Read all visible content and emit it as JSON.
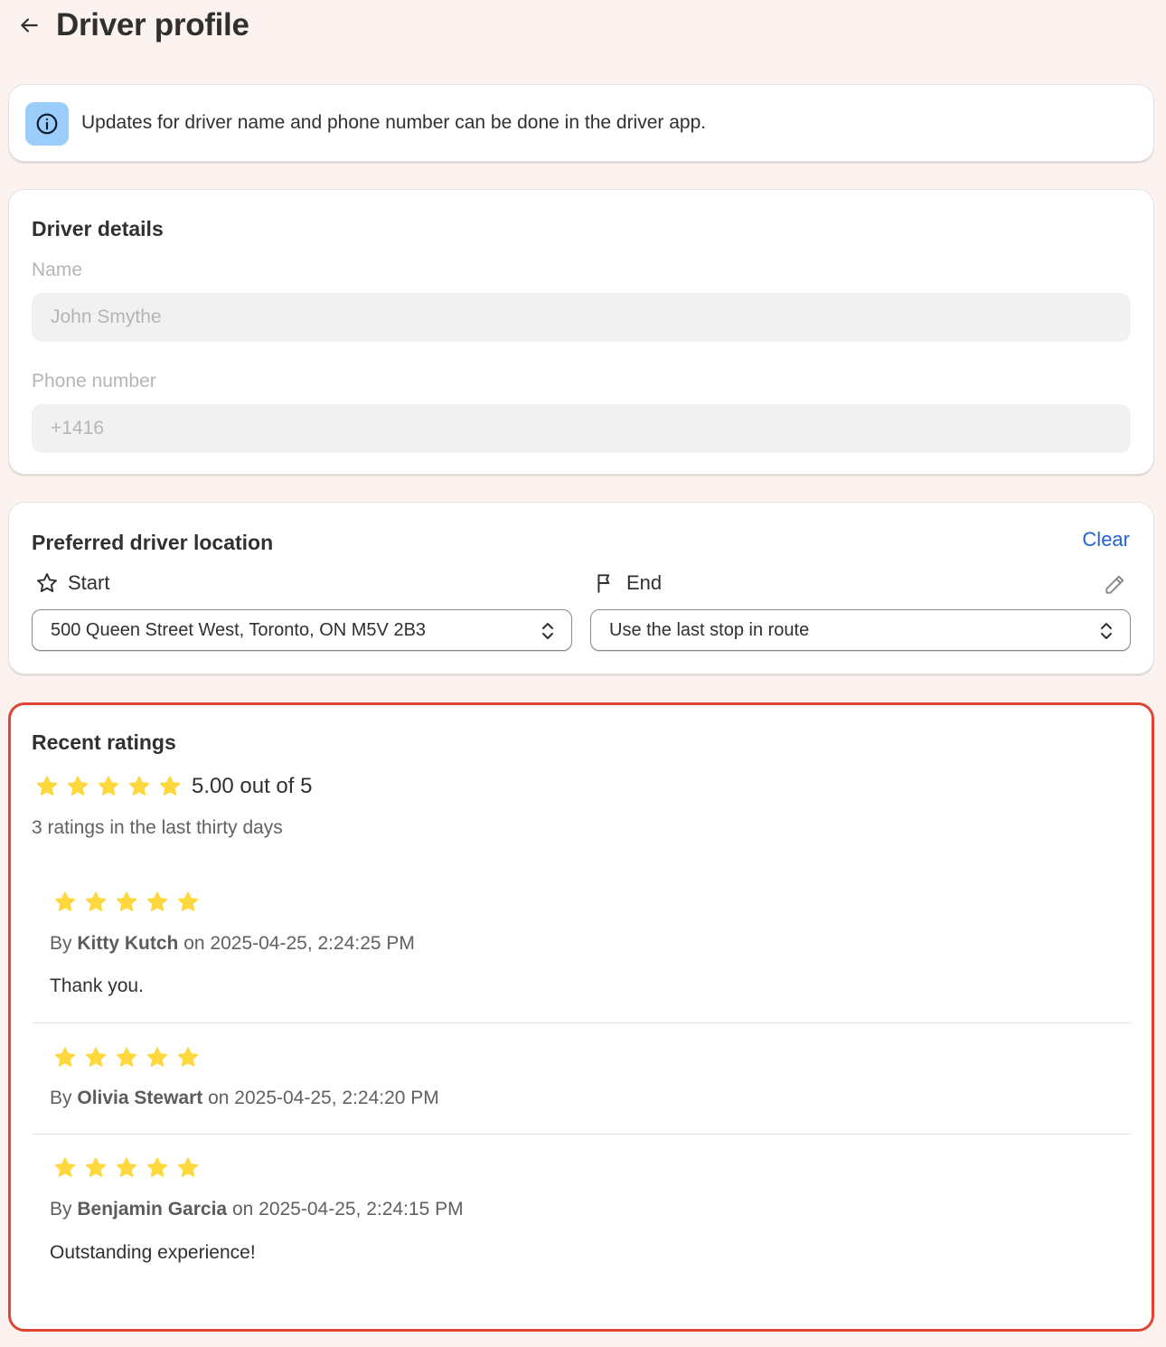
{
  "header": {
    "title": "Driver profile"
  },
  "banner": {
    "text": "Updates for driver name and phone number can be done in the driver app."
  },
  "driver_details": {
    "title": "Driver details",
    "name_label": "Name",
    "name_value": "John Smythe",
    "phone_label": "Phone number",
    "phone_value": "+1416"
  },
  "location": {
    "title": "Preferred driver location",
    "clear_label": "Clear",
    "start_label": "Start",
    "start_value": "500 Queen Street West, Toronto, ON M5V 2B3",
    "end_label": "End",
    "end_value": "Use the last stop in route"
  },
  "ratings": {
    "title": "Recent ratings",
    "average_stars": 5,
    "average_text": "5.00 out of 5",
    "count_text": "3 ratings in the last thirty days",
    "by_prefix": "By",
    "on_word": "on",
    "reviews": [
      {
        "stars": 5,
        "author": "Kitty Kutch",
        "date": "2025-04-25, 2:24:25 PM",
        "comment": "Thank you."
      },
      {
        "stars": 5,
        "author": "Olivia Stewart",
        "date": "2025-04-25, 2:24:20 PM",
        "comment": ""
      },
      {
        "stars": 5,
        "author": "Benjamin Garcia",
        "date": "2025-04-25, 2:24:15 PM",
        "comment": "Outstanding experience!"
      }
    ]
  },
  "colors": {
    "background": "#fcf3f0",
    "accent_link": "#2463d4",
    "star": "#ffd83d",
    "highlight_border": "#e04433",
    "info_icon_bg": "#9bcdfa"
  },
  "icons": {
    "back": "arrow-left-icon",
    "info": "info-icon",
    "start": "star-outline-icon",
    "end": "flag-icon",
    "edit": "pencil-icon",
    "select": "chevron-up-down-icon",
    "rating": "star-filled-icon"
  }
}
